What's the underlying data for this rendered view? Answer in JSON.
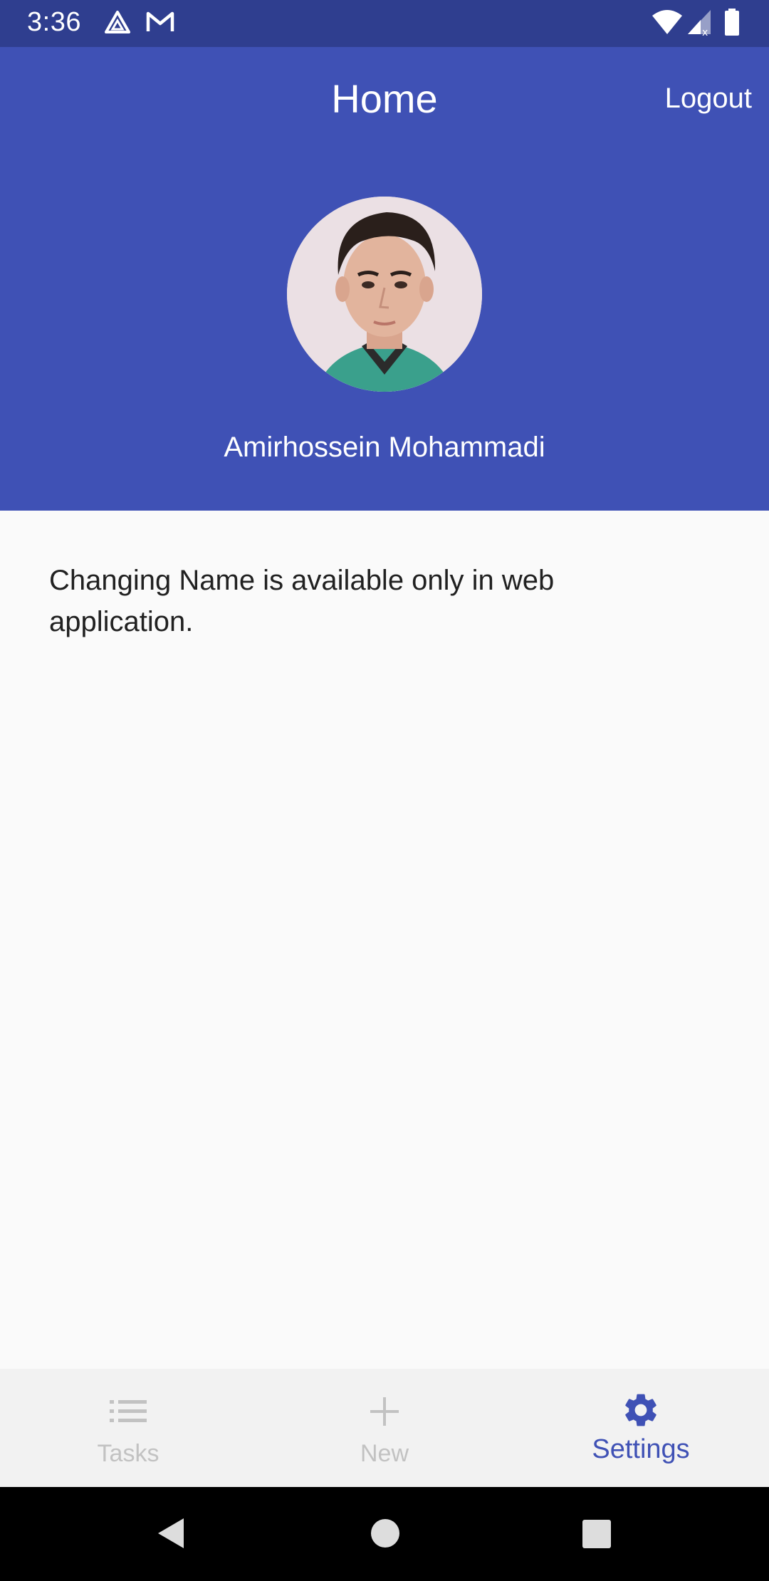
{
  "status_bar": {
    "time": "3:36",
    "icons_left": [
      "drive-icon",
      "gmail-icon"
    ],
    "icons_right": [
      "wifi-icon",
      "signal-icon",
      "battery-icon"
    ]
  },
  "header": {
    "title": "Home",
    "logout_label": "Logout",
    "user_name": "Amirhossein Mohammadi",
    "background_color": "#3f51b5"
  },
  "main": {
    "notice": "Changing Name is available only in web application."
  },
  "bottom_nav": {
    "items": [
      {
        "label": "Tasks",
        "icon": "list-icon",
        "active": false
      },
      {
        "label": "New",
        "icon": "plus-icon",
        "active": false
      },
      {
        "label": "Settings",
        "icon": "gear-icon",
        "active": true
      }
    ],
    "active_color": "#3f51b5",
    "inactive_color": "#c2c2c2"
  },
  "system_nav": {
    "buttons": [
      "back-icon",
      "home-icon",
      "recents-icon"
    ]
  }
}
